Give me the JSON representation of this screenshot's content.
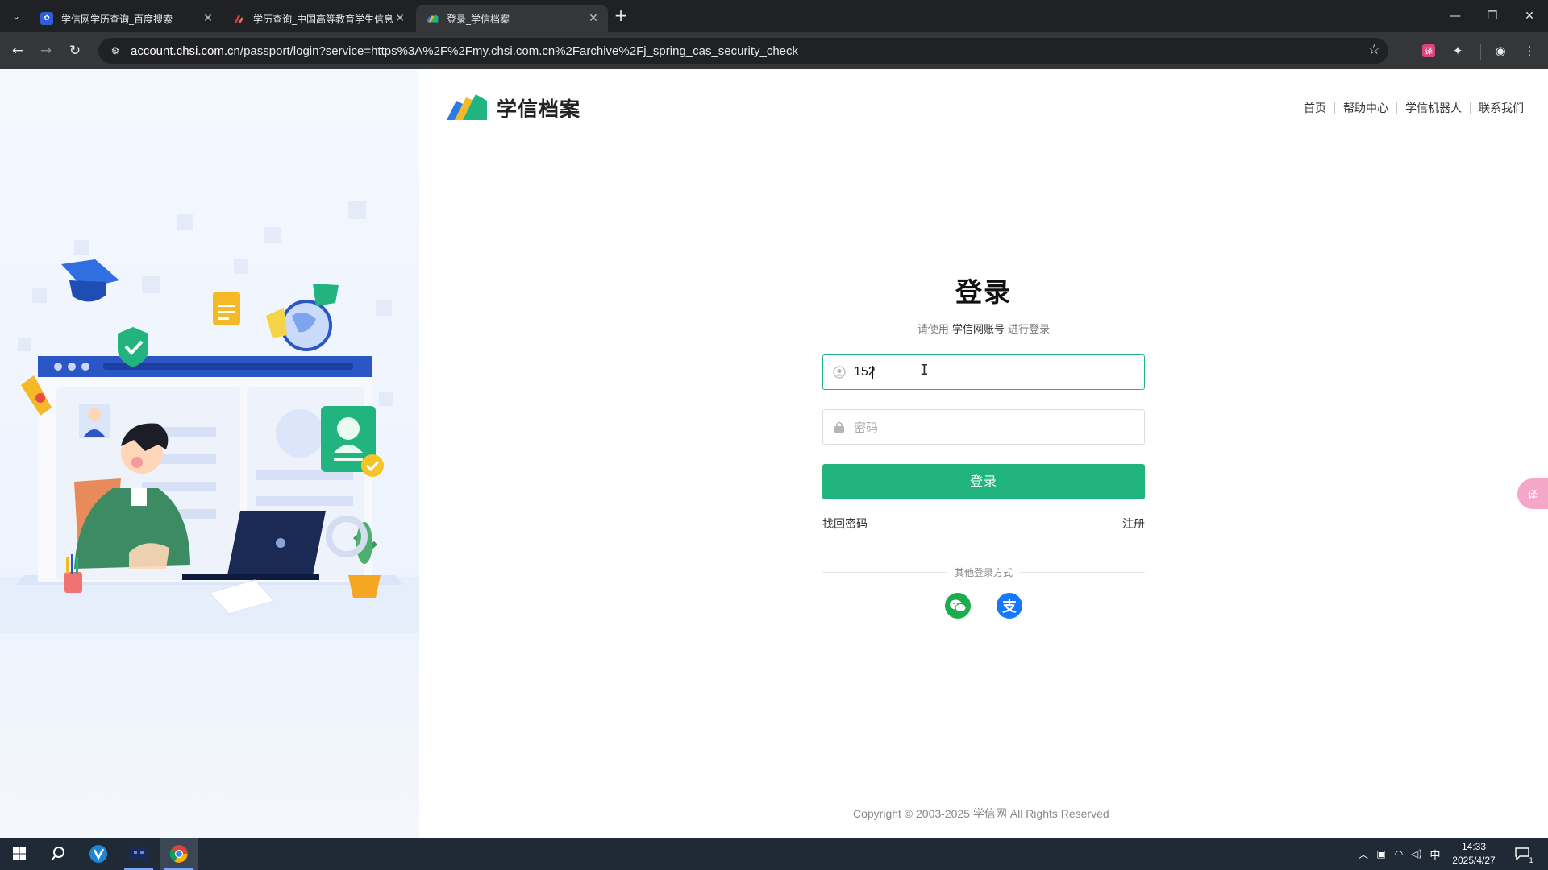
{
  "browser": {
    "tabs": [
      {
        "title": "学信网学历查询_百度搜索",
        "active": false
      },
      {
        "title": "学历查询_中国高等教育学生信息网",
        "active": false
      },
      {
        "title": "登录_学信档案",
        "active": true
      }
    ],
    "url_host": "account.chsi.com.cn",
    "url_rest": "/passport/login?service=https%3A%2F%2Fmy.chsi.com.cn%2Farchive%2Fj_spring_cas_security_check"
  },
  "site": {
    "brand_name": "学信档案",
    "nav": [
      "首页",
      "帮助中心",
      "学信机器人",
      "联系我们"
    ]
  },
  "login": {
    "title": "登录",
    "subtitle_prefix": "请使用",
    "subtitle_account": "学信网账号",
    "subtitle_suffix": "进行登录",
    "username_value": "152",
    "password_placeholder": "密码",
    "submit_label": "登录",
    "forgot_label": "找回密码",
    "register_label": "注册",
    "other_methods_label": "其他登录方式"
  },
  "footer": {
    "copyright": "Copyright © 2003-2025  学信网  All Rights Reserved"
  },
  "taskbar": {
    "ime": "中",
    "time": "14:33",
    "date": "2025/4/27",
    "notifications": "1"
  },
  "colors": {
    "accent_green": "#21b47f",
    "chrome_dark": "#202124",
    "chrome_toolbar": "#35363a"
  }
}
